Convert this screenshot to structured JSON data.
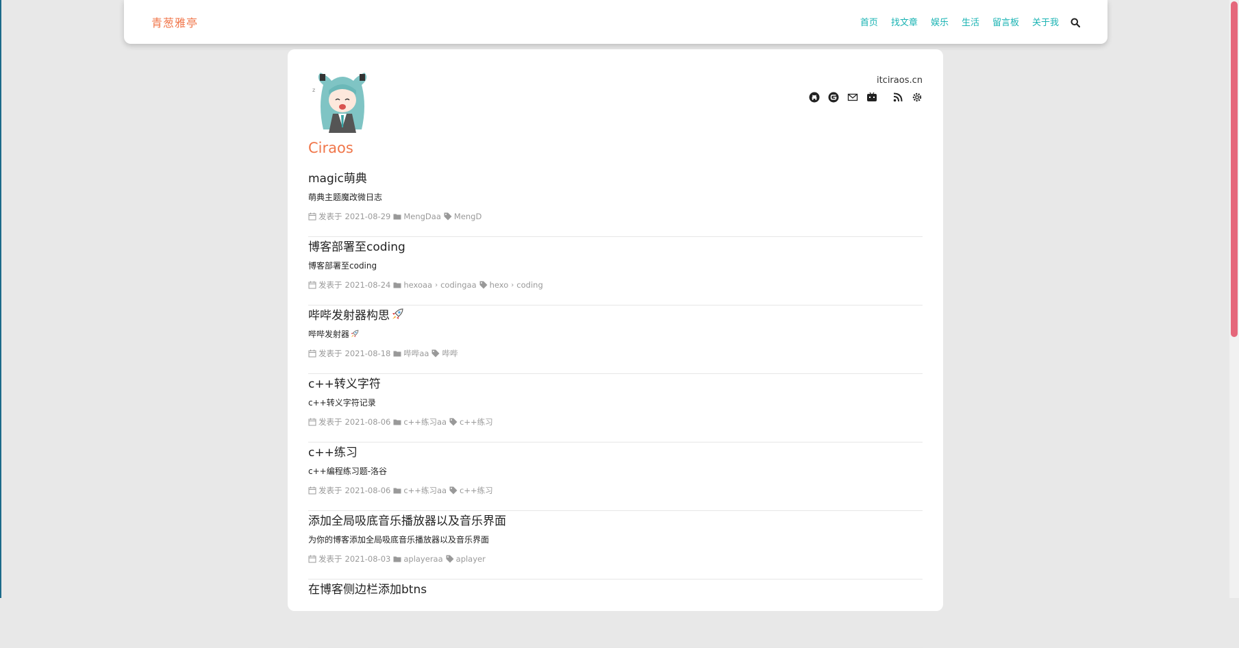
{
  "brand": "青葱雅亭",
  "nav": {
    "items": [
      "首页",
      "找文章",
      "娱乐",
      "生活",
      "留言板",
      "关于我"
    ]
  },
  "profile": {
    "domain": "itciraos.cn",
    "author": "Ciraos",
    "social_icons": [
      "github-icon",
      "gitee-icon",
      "mail-icon",
      "bilibili-icon",
      "rss-icon",
      "settings-icon"
    ]
  },
  "posts": [
    {
      "title": "magic萌典",
      "desc": "萌典主题魔改微日志",
      "date_label": "发表于",
      "date": "2021-08-29",
      "categories": [
        "MengDaa"
      ],
      "tags": [
        "MengD"
      ]
    },
    {
      "title": "博客部署至coding",
      "desc": "博客部署至coding",
      "date_label": "发表于",
      "date": "2021-08-24",
      "categories": [
        "hexoaa",
        "codingaa"
      ],
      "tags": [
        "hexo",
        "coding"
      ]
    },
    {
      "title": "哔哔发射器构思",
      "desc": "哔哔发射器",
      "date_label": "发表于",
      "date": "2021-08-18",
      "categories": [
        "哔哔aa"
      ],
      "tags": [
        "哔哔"
      ]
    },
    {
      "title": "c++转义字符",
      "desc": "c++转义字符记录",
      "date_label": "发表于",
      "date": "2021-08-06",
      "categories": [
        "c++练习aa"
      ],
      "tags": [
        "c++练习"
      ]
    },
    {
      "title": "c++练习",
      "desc": "c++编程练习题-洛谷",
      "date_label": "发表于",
      "date": "2021-08-06",
      "categories": [
        "c++练习aa"
      ],
      "tags": [
        "c++练习"
      ]
    },
    {
      "title": "添加全局吸底音乐播放器以及音乐界面",
      "desc": "为你的博客添加全局吸底音乐播放器以及音乐界面",
      "date_label": "发表于",
      "date": "2021-08-03",
      "categories": [
        "aplayeraa"
      ],
      "tags": [
        "aplayer"
      ]
    },
    {
      "title": "在博客侧边栏添加btns",
      "desc": "",
      "date_label": "",
      "date": "",
      "categories": [],
      "tags": []
    }
  ],
  "colors": {
    "accent": "#f0764a",
    "nav_link": "#19b3b3",
    "meta": "#999999",
    "scroll_thumb": "#e5677b"
  }
}
